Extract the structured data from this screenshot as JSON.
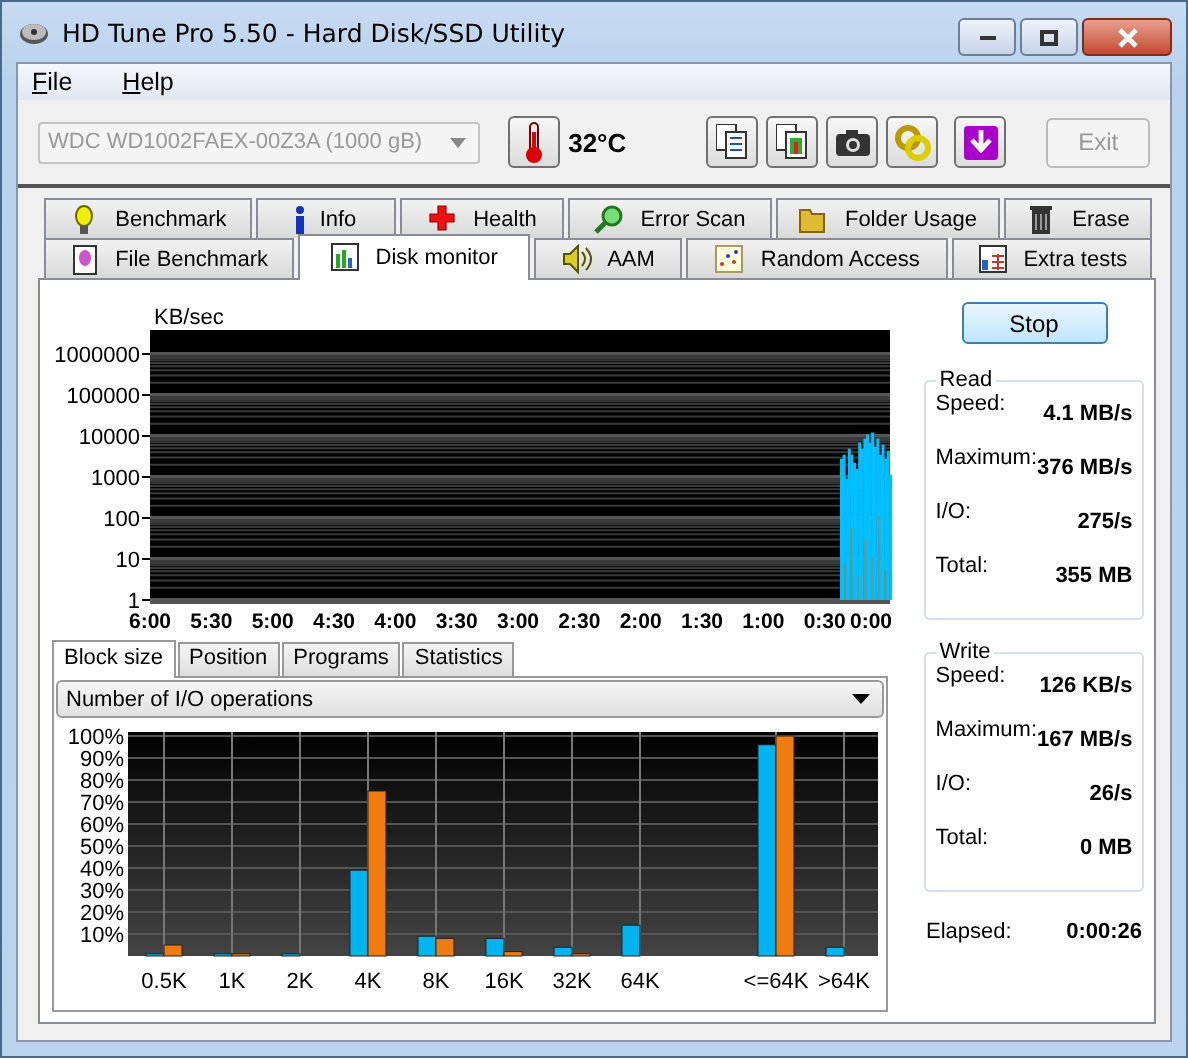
{
  "window": {
    "title": "HD Tune Pro 5.50 - Hard Disk/SSD Utility"
  },
  "menu": [
    {
      "label": "File"
    },
    {
      "label": "Help"
    }
  ],
  "toolbar": {
    "drive": {
      "value": "WDC WD1002FAEX-00Z3A (1000 gB)",
      "disabled": true
    },
    "temperature": "32°C",
    "exit": {
      "label": "Exit",
      "disabled": true
    }
  },
  "tabs_row_1": [
    {
      "label": "Benchmark",
      "selected": false
    },
    {
      "label": "Info",
      "selected": false
    },
    {
      "label": "Health",
      "selected": false
    },
    {
      "label": "Error Scan",
      "selected": false
    },
    {
      "label": "Folder Usage",
      "selected": false
    },
    {
      "label": "Erase",
      "selected": false
    }
  ],
  "tabs_row_2": [
    {
      "label": "File Benchmark",
      "selected": false
    },
    {
      "label": "Disk monitor",
      "selected": true
    },
    {
      "label": "AAM",
      "selected": false
    },
    {
      "label": "Random Access",
      "selected": false
    },
    {
      "label": "Extra tests",
      "selected": false
    }
  ],
  "monitor": {
    "unit": "KB/sec",
    "y_labels": [
      "1000000",
      "100000",
      "10000",
      "1000",
      "100",
      "10",
      "1"
    ],
    "x_labels": [
      "6:00",
      "5:30",
      "5:00",
      "4:30",
      "4:00",
      "3:30",
      "3:00",
      "2:30",
      "2:00",
      "1:30",
      "1:00",
      "0:30",
      "0:00"
    ]
  },
  "stop_button": {
    "label": "Stop"
  },
  "read": {
    "title": "Read",
    "fields": [
      {
        "label": "Speed:",
        "value": "4.1 MB/s"
      },
      {
        "label": "Maximum:",
        "value": "376 MB/s"
      },
      {
        "label": "I/O:",
        "value": "275/s"
      },
      {
        "label": "Total:",
        "value": "355 MB"
      }
    ]
  },
  "write": {
    "title": "Write",
    "fields": [
      {
        "label": "Speed:",
        "value": "126 KB/s"
      },
      {
        "label": "Maximum:",
        "value": "167 MB/s"
      },
      {
        "label": "I/O:",
        "value": "26/s"
      },
      {
        "label": "Total:",
        "value": "0 MB"
      }
    ]
  },
  "elapsed": {
    "label": "Elapsed:",
    "value": "0:00:26"
  },
  "subtabs": [
    {
      "label": "Block size",
      "selected": true
    },
    {
      "label": "Position",
      "selected": false
    },
    {
      "label": "Programs",
      "selected": false
    },
    {
      "label": "Statistics",
      "selected": false
    }
  ],
  "dropdown": {
    "value": "Number of I/O operations"
  },
  "block_chart": {
    "chart_data": {
      "type": "bar",
      "categories": [
        "0.5K",
        "1K",
        "2K",
        "4K",
        "8K",
        "16K",
        "32K",
        "64K",
        "<=64K",
        ">64K"
      ],
      "grid": true,
      "ylim": [
        0,
        100
      ],
      "yticks": [
        {
          "value": 10,
          "label": "10%"
        },
        {
          "value": 20,
          "label": "20%"
        },
        {
          "value": 30,
          "label": "30%"
        },
        {
          "value": 40,
          "label": "40%"
        },
        {
          "value": 50,
          "label": "50%"
        },
        {
          "value": 60,
          "label": "60%"
        },
        {
          "value": 70,
          "label": "70%"
        },
        {
          "value": 80,
          "label": "80%"
        },
        {
          "value": 90,
          "label": "90%"
        },
        {
          "value": 100,
          "label": "100%"
        }
      ],
      "series": [
        {
          "color": "#00b4f0",
          "values": [
            1,
            1,
            1,
            39,
            9,
            8,
            4,
            14,
            96,
            4
          ]
        },
        {
          "color": "#f07c10",
          "values": [
            5,
            1,
            0,
            75,
            8,
            2,
            1,
            0,
            100,
            0
          ]
        }
      ]
    }
  }
}
